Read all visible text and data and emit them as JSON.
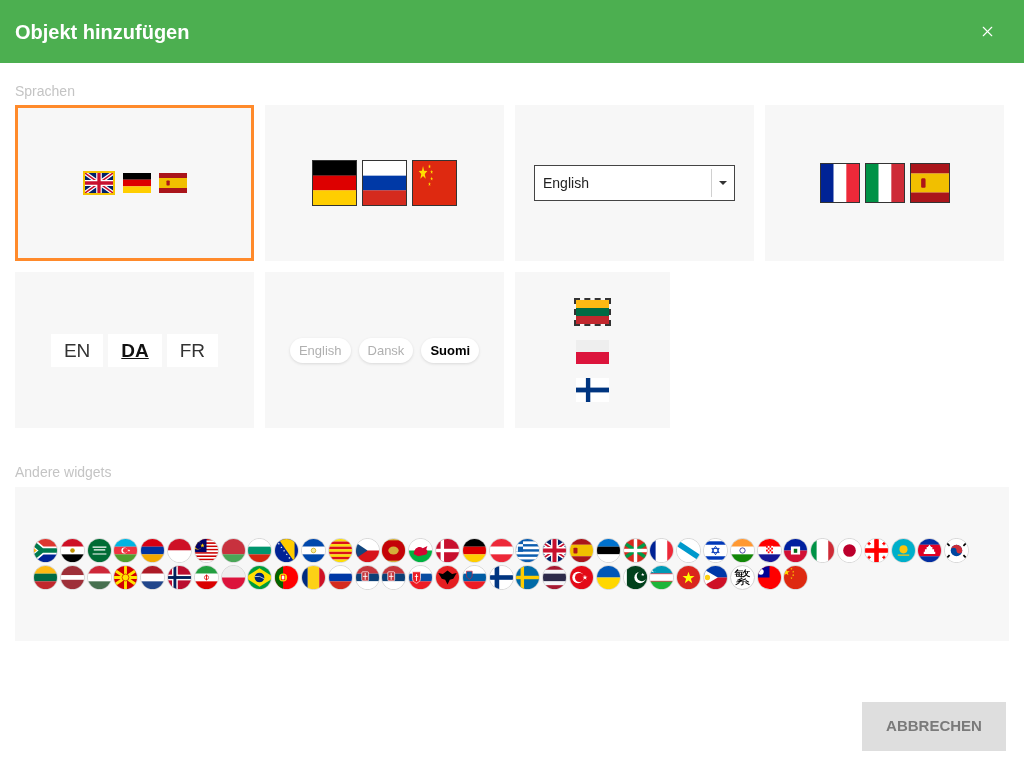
{
  "dialog": {
    "title": "Objekt hinzufügen"
  },
  "sections": [
    {
      "label": "Sprachen",
      "cards": [
        {
          "kind": "flag_row",
          "selected": true,
          "flags": [
            {
              "selected": true
            },
            {
              "selected": false
            },
            {
              "selected": false
            }
          ]
        },
        {
          "kind": "large_flags",
          "selected": false,
          "flags": [
            {
              "selected": false
            },
            {
              "selected": false
            },
            {
              "selected": false
            }
          ]
        },
        {
          "kind": "dropdown",
          "selected": false,
          "value": "English"
        },
        {
          "kind": "flag_tiles",
          "selected": false,
          "flags": [
            {
              "selected": false
            },
            {
              "selected": false
            },
            {
              "selected": false
            }
          ]
        },
        {
          "kind": "code_buttons",
          "selected": false,
          "options": [
            {
              "label": "EN",
              "selected": false
            },
            {
              "label": "DA",
              "selected": true
            },
            {
              "label": "FR",
              "selected": false
            }
          ]
        },
        {
          "kind": "pills",
          "selected": false,
          "options": [
            {
              "label": "English",
              "selected": false
            },
            {
              "label": "Dansk",
              "selected": false
            },
            {
              "label": "Suomi",
              "selected": true
            }
          ]
        },
        {
          "kind": "flag_column",
          "selected": false,
          "flags": [
            {
              "selected": true
            },
            {
              "selected": false
            },
            {
              "selected": false
            }
          ]
        }
      ]
    },
    {
      "label": "Andere widgets",
      "cards": [
        {
          "kind": "flag_circles",
          "selected": false,
          "character": "繁"
        }
      ]
    }
  ],
  "buttons": [
    {
      "label": "ABBRECHEN"
    }
  ]
}
